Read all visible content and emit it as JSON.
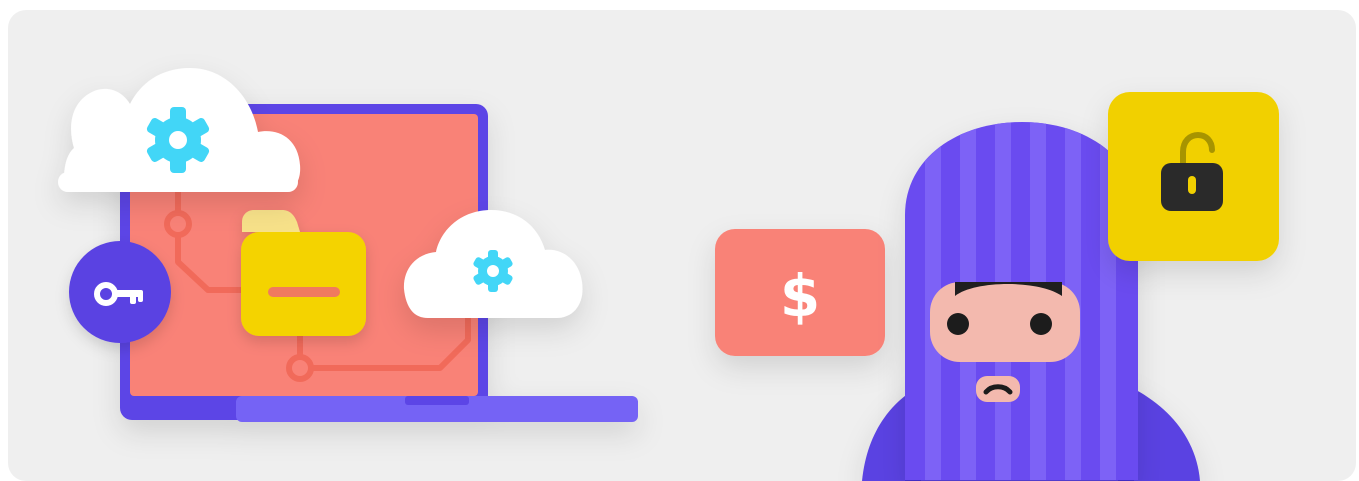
{
  "scene": {
    "money_tag": {
      "symbol": "$"
    },
    "icons": [
      "cloud-gear-icon",
      "laptop-icon",
      "folder-icon",
      "key-icon",
      "circuit-lines-icon",
      "dollar-icon",
      "hacker-balaclava-icon",
      "unlocked-padlock-icon"
    ],
    "colors": {
      "background": "#efefef",
      "laptop_frame": "#5b45e6",
      "laptop_screen": "#f98277",
      "laptop_base": "#7464f5",
      "circuit": "#f06655",
      "cloud": "#ffffff",
      "gear": "#42d6f7",
      "folder": "#f4d300",
      "key_badge": "#5a43e2",
      "money_tag": "#f98277",
      "hacker_mask": "#6a4bf0",
      "hacker_mask_stripe": "#7d62f6",
      "hacker_face": "#f3b9ae",
      "padlock_card": "#f1d000",
      "padlock": "#2c2c2c"
    }
  }
}
